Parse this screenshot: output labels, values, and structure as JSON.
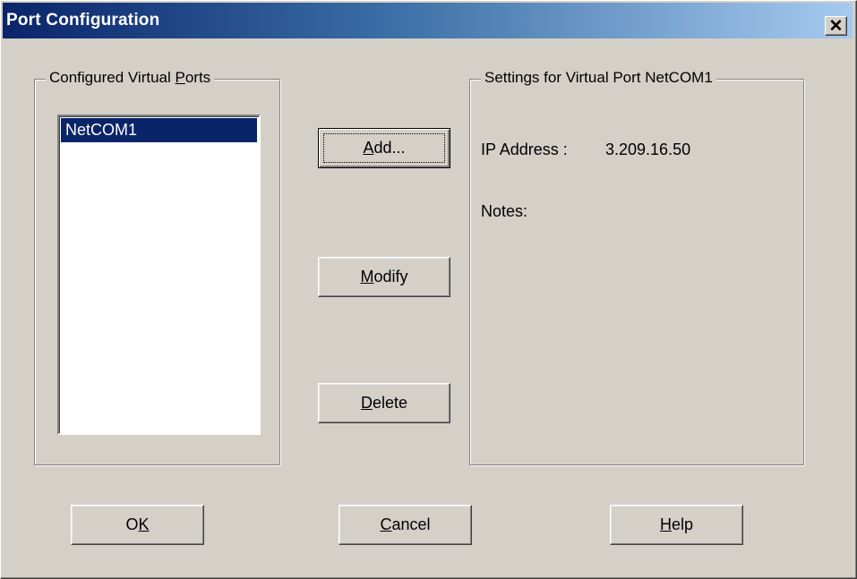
{
  "window": {
    "title": "Port Configuration",
    "close_glyph": "✕"
  },
  "ports_group": {
    "legend_pre": "Configured Virtual ",
    "legend_mnemonic": "P",
    "legend_post": "orts",
    "items": [
      "NetCOM1"
    ],
    "selected_index": 0
  },
  "actions": {
    "add": {
      "pre": "",
      "mnemonic": "A",
      "post": "dd..."
    },
    "modify": {
      "pre": "",
      "mnemonic": "M",
      "post": "odify"
    },
    "delete": {
      "pre": "",
      "mnemonic": "D",
      "post": "elete"
    }
  },
  "settings_group": {
    "legend": "Settings for Virtual Port  NetCOM1",
    "ip_label": "IP Address :",
    "ip_value": "3.209.16.50",
    "notes_label": "Notes:"
  },
  "footer": {
    "ok": {
      "pre": "O",
      "mnemonic": "K",
      "post": ""
    },
    "cancel": {
      "pre": "",
      "mnemonic": "C",
      "post": "ancel"
    },
    "help": {
      "pre": "",
      "mnemonic": "H",
      "post": "elp"
    }
  },
  "icons": {
    "close": "close-icon"
  }
}
